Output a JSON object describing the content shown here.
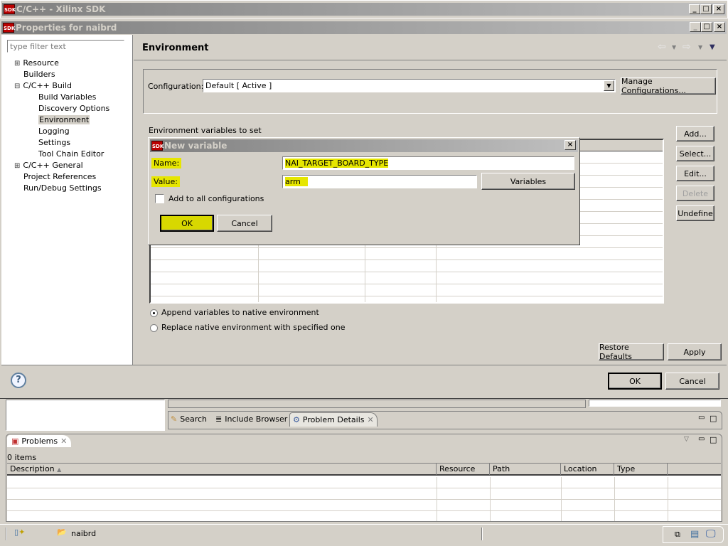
{
  "main_window": {
    "title": "C/C++ - Xilinx SDK",
    "app_icon": "SDK"
  },
  "properties_dialog": {
    "title": "Properties for naibrd",
    "filter_placeholder": "type filter text",
    "tree": [
      {
        "label": "Resource",
        "expander": "+"
      },
      {
        "label": "Builders"
      },
      {
        "label": "C/C++ Build",
        "expander": "-"
      },
      {
        "label": "Build Variables"
      },
      {
        "label": "Discovery Options"
      },
      {
        "label": "Environment",
        "selected": true
      },
      {
        "label": "Logging"
      },
      {
        "label": "Settings"
      },
      {
        "label": "Tool Chain Editor"
      },
      {
        "label": "C/C++ General",
        "expander": "+"
      },
      {
        "label": "Project References"
      },
      {
        "label": "Run/Debug Settings"
      }
    ],
    "page_title": "Environment",
    "configuration_label": "Configuration:",
    "configuration_value": "Default  [ Active ]",
    "manage_configurations": "Manage Configurations...",
    "env_vars_label": "Environment variables to set",
    "side_buttons": {
      "add": "Add...",
      "select": "Select...",
      "edit": "Edit...",
      "delete": "Delete",
      "undefine": "Undefine"
    },
    "radio_append": "Append variables to native environment",
    "radio_replace": "Replace native environment with specified one",
    "restore_defaults": "Restore Defaults",
    "apply": "Apply",
    "ok": "OK",
    "cancel": "Cancel"
  },
  "new_variable_dialog": {
    "title": "New variable",
    "name_label": "Name:",
    "name_value": "NAI_TARGET_BOARD_TYPE",
    "value_label": "Value:",
    "value_value": "arm",
    "variables_button": "Variables",
    "add_to_all_label": "Add to all configurations",
    "ok": "OK",
    "cancel": "Cancel",
    "highlight_color": "#e6e600"
  },
  "bottom": {
    "tabs": [
      "Search",
      "Include Browser",
      "Problem Details"
    ],
    "problems_tab": "Problems",
    "items_count": "0 items",
    "columns": [
      "Description",
      "Resource",
      "Path",
      "Location",
      "Type"
    ],
    "status_project": "naibrd"
  }
}
